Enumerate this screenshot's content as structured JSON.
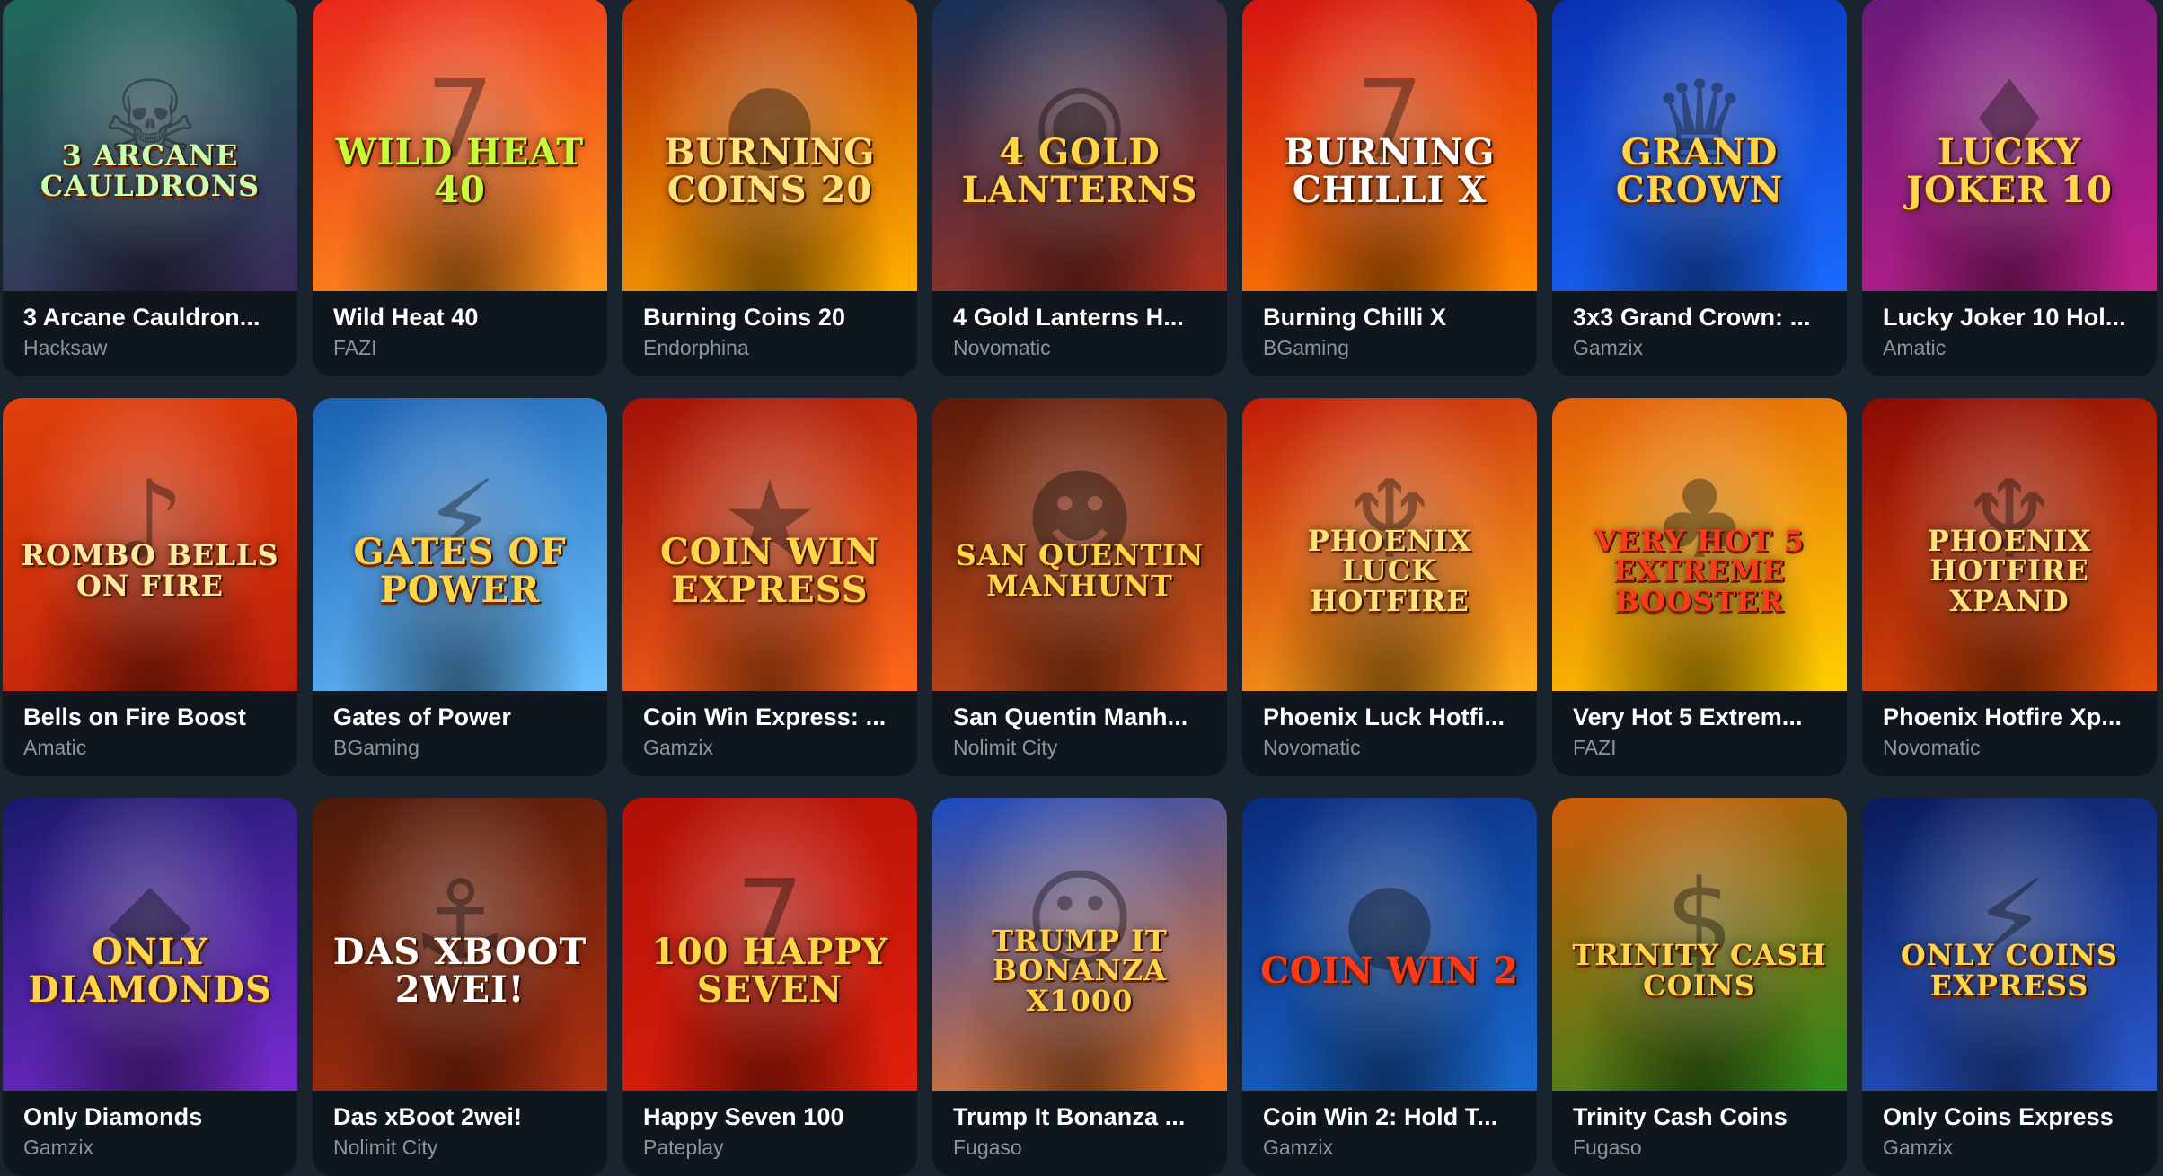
{
  "games": [
    {
      "title": "3 Arcane Cauldron...",
      "provider": "Hacksaw",
      "art": "3 ARCANE CAULDRONS",
      "icon": "cauldron-icon",
      "glyph": "☠",
      "bg": [
        "#1f6b5a",
        "#3a2a5a"
      ],
      "color": "#c8ffb0"
    },
    {
      "title": "Wild Heat 40",
      "provider": "FAZI",
      "art": "Wild Heat 40",
      "icon": "seven-icon",
      "glyph": "7",
      "bg": [
        "#e8251c",
        "#ff9a1a"
      ],
      "color": "#c6ff3a"
    },
    {
      "title": "Burning Coins 20",
      "provider": "Endorphina",
      "art": "BURNING COINS 20",
      "icon": "coin-icon",
      "glyph": "●",
      "bg": [
        "#b82a05",
        "#ffb000"
      ],
      "color": "#ffe27a"
    },
    {
      "title": "4 Gold Lanterns H...",
      "provider": "Novomatic",
      "art": "4 GOLD LANTERNS",
      "icon": "lantern-icon",
      "glyph": "◉",
      "bg": [
        "#12305a",
        "#b0301a"
      ],
      "color": "#ffd54a"
    },
    {
      "title": "Burning Chilli X",
      "provider": "BGaming",
      "art": "BURNING CHILLI X",
      "icon": "chilli-icon",
      "glyph": "7",
      "bg": [
        "#d41212",
        "#ff8a00"
      ],
      "color": "#ffffff"
    },
    {
      "title": "3x3 Grand Crown: ...",
      "provider": "Gamzix",
      "art": "GRAND CROWN",
      "icon": "crown-icon",
      "glyph": "♛",
      "bg": [
        "#0a2fb0",
        "#1a6bff"
      ],
      "color": "#ffd54a"
    },
    {
      "title": "Lucky Joker 10 Hol...",
      "provider": "Amatic",
      "art": "LUCKY JOKER 10",
      "icon": "joker-icon",
      "glyph": "♦",
      "bg": [
        "#6a1a7a",
        "#c0208a"
      ],
      "color": "#ffd54a"
    },
    {
      "title": "Bells on Fire Boost",
      "provider": "Amatic",
      "art": "ROMBO Bells On Fire",
      "icon": "bell-icon",
      "glyph": "♪",
      "bg": [
        "#e0400a",
        "#c0200a"
      ],
      "color": "#ffe9a0"
    },
    {
      "title": "Gates of Power",
      "provider": "BGaming",
      "art": "GATES OF POWER",
      "icon": "zeus-icon",
      "glyph": "⚡",
      "bg": [
        "#1a5fb0",
        "#6ac0ff"
      ],
      "color": "#ffd54a"
    },
    {
      "title": "Coin Win Express: ...",
      "provider": "Gamzix",
      "art": "COIN WIN EXPRESS",
      "icon": "coin-icon",
      "glyph": "★",
      "bg": [
        "#a01008",
        "#ff6a1a"
      ],
      "color": "#ffd54a"
    },
    {
      "title": "San Quentin Manh...",
      "provider": "Nolimit City",
      "art": "SAN QUENTIN MANHUNT",
      "icon": "prisoner-icon",
      "glyph": "☻",
      "bg": [
        "#5a1a0a",
        "#d0501a"
      ],
      "color": "#ffd54a"
    },
    {
      "title": "Phoenix Luck Hotfi...",
      "provider": "Novomatic",
      "art": "PHOENIX LUCK HOTFIRE",
      "icon": "phoenix-icon",
      "glyph": "♆",
      "bg": [
        "#c01a0a",
        "#ffb01a"
      ],
      "color": "#ffe27a"
    },
    {
      "title": "Very Hot 5 Extrem...",
      "provider": "FAZI",
      "art": "VERY HOT 5 Extreme Booster",
      "icon": "clover-icon",
      "glyph": "♣",
      "bg": [
        "#e05a0a",
        "#ffd000"
      ],
      "color": "#ff3a1a"
    },
    {
      "title": "Phoenix Hotfire Xp...",
      "provider": "Novomatic",
      "art": "PHOENIX HOTFIRE XPAND",
      "icon": "phoenix-icon",
      "glyph": "♆",
      "bg": [
        "#8a0a05",
        "#e0500a"
      ],
      "color": "#ffe27a"
    },
    {
      "title": "Only Diamonds",
      "provider": "Gamzix",
      "art": "Only DIAMONDS",
      "icon": "diamond-icon",
      "glyph": "◆",
      "bg": [
        "#1a1a6a",
        "#7a2ad0"
      ],
      "color": "#ffd54a"
    },
    {
      "title": "Das xBoot 2wei!",
      "provider": "Nolimit City",
      "art": "Das xBoot 2wei!",
      "icon": "captain-icon",
      "glyph": "⚓",
      "bg": [
        "#4a1a0a",
        "#b03010"
      ],
      "color": "#ffffff"
    },
    {
      "title": "Happy Seven 100",
      "provider": "Pateplay",
      "art": "100 HAPPY SEVEN",
      "icon": "seven-icon",
      "glyph": "7",
      "bg": [
        "#b01008",
        "#e0200a"
      ],
      "color": "#ffd54a"
    },
    {
      "title": "Trump It Bonanza ...",
      "provider": "Fugaso",
      "art": "TRUMP IT BONANZA X1000",
      "icon": "face-icon",
      "glyph": "☺",
      "bg": [
        "#1a4ac0",
        "#ff7a1a"
      ],
      "color": "#ffd54a"
    },
    {
      "title": "Coin Win 2: Hold T...",
      "provider": "Gamzix",
      "art": "COIN WIN 2",
      "icon": "coin-icon",
      "glyph": "●",
      "bg": [
        "#0a2a7a",
        "#1a6ad0"
      ],
      "color": "#ff3a1a"
    },
    {
      "title": "Trinity Cash Coins",
      "provider": "Fugaso",
      "art": "TRINITY CASH COINS",
      "icon": "coin-icon",
      "glyph": "$",
      "bg": [
        "#d05a0a",
        "#2a8a1a"
      ],
      "color": "#ffd54a"
    },
    {
      "title": "Only Coins Express",
      "provider": "Gamzix",
      "art": "ONLY COINS EXPRESS",
      "icon": "train-icon",
      "glyph": "⚡",
      "bg": [
        "#0a1a5a",
        "#2a5ad0"
      ],
      "color": "#ffd54a"
    }
  ]
}
